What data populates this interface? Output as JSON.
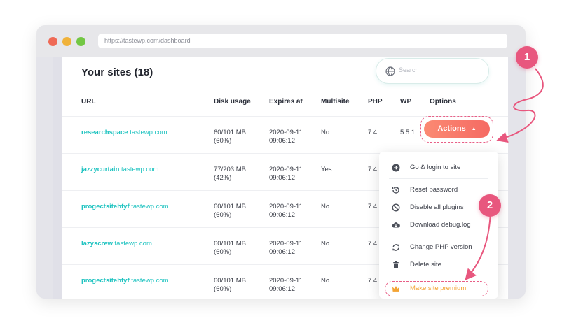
{
  "browser": {
    "url": "https://tastewp.com/dashboard"
  },
  "page": {
    "title": "Your sites (18)",
    "search_placeholder": "Search"
  },
  "table": {
    "headers": {
      "url": "URL",
      "disk": "Disk usage",
      "expires": "Expires at",
      "multisite": "Multisite",
      "php": "PHP",
      "wp": "WP",
      "options": "Options"
    },
    "rows": [
      {
        "sub": "researchspace",
        "domain": ".tastewp.com",
        "disk1": "60/101 MB",
        "disk2": "(60%)",
        "exp1": "2020-09-11",
        "exp2": "09:06:12",
        "multisite": "No",
        "php": "7.4",
        "wp": "5.5.1"
      },
      {
        "sub": "jazzycurtain",
        "domain": ".tastewp.com",
        "disk1": "77/203 MB",
        "disk2": "(42%)",
        "exp1": "2020-09-11",
        "exp2": "09:06:12",
        "multisite": "Yes",
        "php": "7.4",
        "wp": ""
      },
      {
        "sub": "progectsitehfyf",
        "domain": ".tastewp.com",
        "disk1": "60/101 MB",
        "disk2": "(60%)",
        "exp1": "2020-09-11",
        "exp2": "09:06:12",
        "multisite": "No",
        "php": "7.4",
        "wp": ""
      },
      {
        "sub": "lazyscrew",
        "domain": ".tastewp.com",
        "disk1": "60/101 MB",
        "disk2": "(60%)",
        "exp1": "2020-09-11",
        "exp2": "09:06:12",
        "multisite": "No",
        "php": "7.4",
        "wp": ""
      },
      {
        "sub": "progectsitehfyf",
        "domain": ".tastewp.com",
        "disk1": "60/101 MB",
        "disk2": "(60%)",
        "exp1": "2020-09-11",
        "exp2": "09:06:12",
        "multisite": "No",
        "php": "7.4",
        "wp": ""
      }
    ]
  },
  "actions": {
    "label": "Actions",
    "caret": "▲"
  },
  "menu": {
    "items": [
      {
        "label": "Go & login to site",
        "icon": "arrow-right-circle-icon"
      },
      {
        "label": "Reset password",
        "icon": "history-icon"
      },
      {
        "label": "Disable all plugins",
        "icon": "ban-icon"
      },
      {
        "label": "Download debug.log",
        "icon": "cloud-download-icon"
      },
      {
        "label": "Change PHP version",
        "icon": "sync-icon"
      },
      {
        "label": "Delete site",
        "icon": "trash-icon"
      },
      {
        "label": "Make site premium",
        "icon": "crown-icon"
      }
    ]
  },
  "callouts": {
    "step1": "1",
    "step2": "2"
  },
  "colors": {
    "accent_teal": "#1ec3c0",
    "actions_orange": "#f56a63",
    "callout_pink": "#e8577e",
    "premium_gold": "#f3a434"
  }
}
